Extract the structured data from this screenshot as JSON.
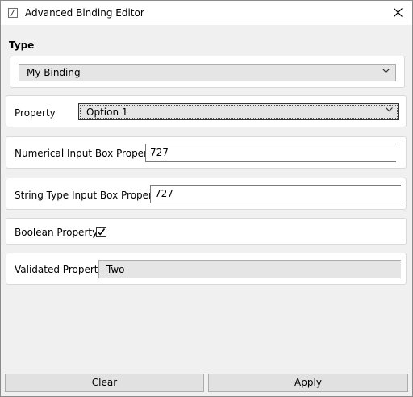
{
  "window": {
    "title": "Advanced Binding Editor",
    "icon": "edit-icon",
    "close_icon": "close-icon"
  },
  "type_section": {
    "heading": "Type",
    "selected": "My Binding"
  },
  "property": {
    "label": "Property",
    "selected": "Option 1"
  },
  "numerical": {
    "label": "Numerical Input Box Property",
    "value": "727"
  },
  "string_prop": {
    "label": "String Type Input Box Property",
    "value": "727"
  },
  "boolean_prop": {
    "label": "Boolean Property",
    "checked": true
  },
  "validated": {
    "label": "Validated Property",
    "value": "Two"
  },
  "buttons": {
    "clear": "Clear",
    "apply": "Apply"
  }
}
